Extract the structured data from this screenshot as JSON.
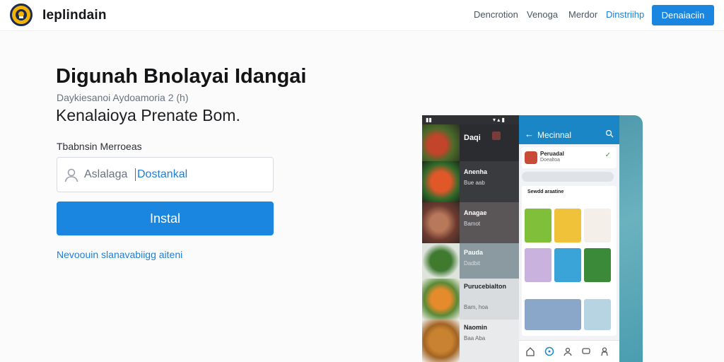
{
  "header": {
    "brand": "Ieplindain",
    "nav": [
      "Dencrotion",
      "Venoga",
      "Merdor",
      "Dinstriihp"
    ],
    "cta": "Denaiaciin"
  },
  "hero": {
    "title": "Digunah Bnolayai Idangai",
    "subtitle": "Daykiesanoi Aydoamoria 2 (h)",
    "tagline": "Kenalaioya Prenate Bom.",
    "field_label": "Tbabnsin Merroeas",
    "input_prefix": "Aslalaga",
    "input_value": "Dostankal",
    "install_label": "Instal",
    "link_text": "Nevoouin slanavabiigg aiteni"
  },
  "phone": {
    "left_list": [
      {
        "title": "Daqi",
        "sub": ""
      },
      {
        "title": "Anenha",
        "sub": "Bue aab"
      },
      {
        "title": "Anagae",
        "sub": "Bamot"
      },
      {
        "title": "Pauda",
        "sub": "Dadbit"
      },
      {
        "title": "Purucebialton",
        "sub": "Bam, hoa"
      },
      {
        "title": "Naomin",
        "sub": "Baa Aba"
      }
    ],
    "app_title": "Mecinnal",
    "card1_title": "Peruadal",
    "card1_sub": "Doealtoa",
    "card2_title": "Sewdd araatine"
  },
  "colors": {
    "accent": "#1b86e0",
    "link": "#1e7ed8",
    "logo_yellow": "#f2b400",
    "logo_navy": "#1d2a52"
  },
  "icons": [
    "logo-icon",
    "user-icon",
    "back-arrow-icon",
    "search-icon",
    "home-icon",
    "compass-icon",
    "profile-icon",
    "chat-icon",
    "person-icon"
  ]
}
